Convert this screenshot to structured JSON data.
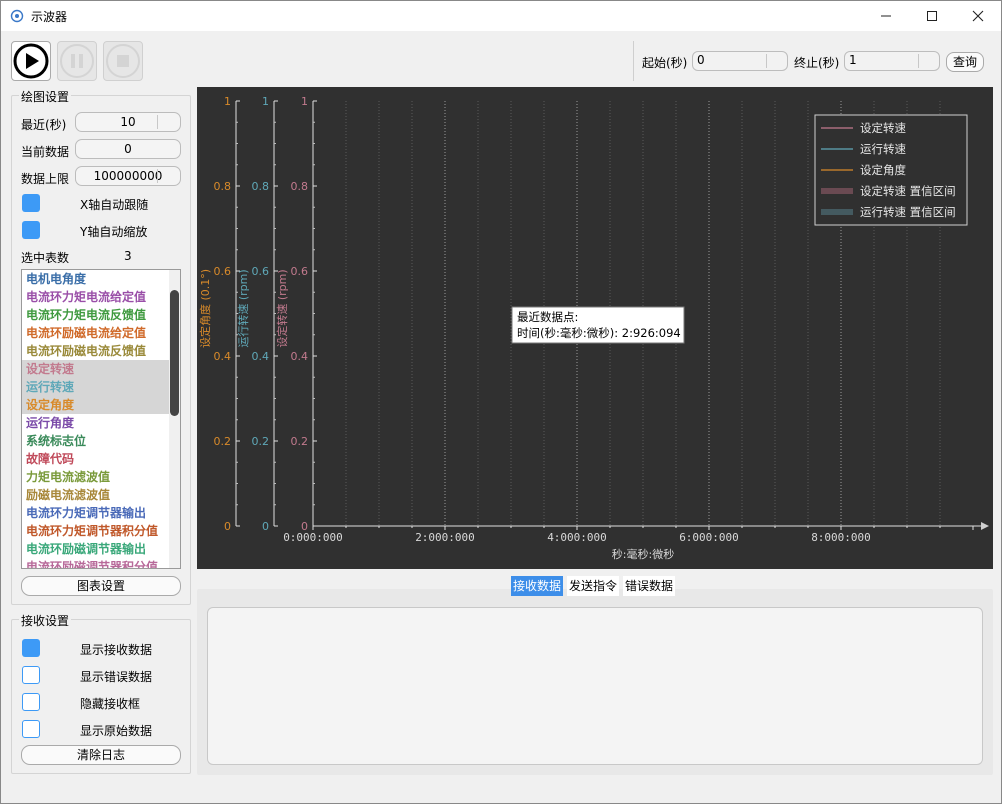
{
  "window": {
    "title": "示波器",
    "min_icon": "minimize-icon",
    "max_icon": "maximize-icon",
    "close_icon": "close-icon"
  },
  "toolbar": {
    "play_icon": "play-icon",
    "pause_icon": "pause-icon",
    "stop_icon": "stop-icon"
  },
  "query": {
    "start_label": "起始(秒)",
    "start_value": "0",
    "end_label": "终止(秒)",
    "end_value": "1",
    "button": "查询"
  },
  "plot_settings": {
    "title": "绘图设置",
    "recent_label": "最近(秒)",
    "recent_value": "10",
    "current_label": "当前数据",
    "current_value": "0",
    "limit_label": "数据上限",
    "limit_value": "100000000",
    "x_follow": "X轴自动跟随",
    "y_scale": "Y轴自动缩放",
    "selected_label": "选中表数",
    "selected_value": "3",
    "chart_settings_button": "图表设置",
    "items": [
      {
        "label": "电机电角度",
        "color": "#3a6ea8",
        "selected": false
      },
      {
        "label": "电流环力矩电流给定值",
        "color": "#9a4fa8",
        "selected": false
      },
      {
        "label": "电流环力矩电流反馈值",
        "color": "#3f9a3f",
        "selected": false
      },
      {
        "label": "电流环励磁电流给定值",
        "color": "#d06a2a",
        "selected": false
      },
      {
        "label": "电流环励磁电流反馈值",
        "color": "#9a8a3a",
        "selected": false
      },
      {
        "label": "设定转速",
        "color": "#c27a8e",
        "selected": true
      },
      {
        "label": "运行转速",
        "color": "#5fa8b8",
        "selected": true
      },
      {
        "label": "设定角度",
        "color": "#d88a2a",
        "selected": true
      },
      {
        "label": "运行角度",
        "color": "#7a4aa8",
        "selected": false
      },
      {
        "label": "系统标志位",
        "color": "#3a8a5a",
        "selected": false
      },
      {
        "label": "故障代码",
        "color": "#c04a5a",
        "selected": false
      },
      {
        "label": "力矩电流滤波值",
        "color": "#7a9a3a",
        "selected": false
      },
      {
        "label": "励磁电流滤波值",
        "color": "#a8883a",
        "selected": false
      },
      {
        "label": "电流环力矩调节器输出",
        "color": "#4a6ab8",
        "selected": false
      },
      {
        "label": "电流环力矩调节器积分值",
        "color": "#c0582a",
        "selected": false
      },
      {
        "label": "电流环励磁调节器输出",
        "color": "#3aa87a",
        "selected": false
      },
      {
        "label": "电流环励磁调节器积分值",
        "color": "#b86a9a",
        "selected": false
      }
    ]
  },
  "receive_settings": {
    "title": "接收设置",
    "options": [
      {
        "label": "显示接收数据",
        "checked": true
      },
      {
        "label": "显示错误数据",
        "checked": false
      },
      {
        "label": "隐藏接收框",
        "checked": false
      },
      {
        "label": "显示原始数据",
        "checked": false
      }
    ],
    "clear_button": "清除日志"
  },
  "tabs": [
    {
      "label": "接收数据",
      "active": true
    },
    {
      "label": "发送指令",
      "active": false
    },
    {
      "label": "错误数据",
      "active": false
    }
  ],
  "chart_data": {
    "type": "line",
    "x_ticks": [
      "0:000:000",
      "2:000:000",
      "4:000:000",
      "6:000:000",
      "8:000:000"
    ],
    "xlabel": "秒:毫秒:微秒",
    "y_axes": [
      {
        "label": "设定角度 (0.1°)",
        "color": "#d88a2a",
        "ticks": [
          "0",
          "0.2",
          "0.4",
          "0.6",
          "0.8",
          "1"
        ]
      },
      {
        "label": "运行转速 (rpm)",
        "color": "#5fa8b8",
        "ticks": [
          "0",
          "0.2",
          "0.4",
          "0.6",
          "0.8",
          "1"
        ]
      },
      {
        "label": "设定转速 (rpm)",
        "color": "#c27a8e",
        "ticks": [
          "0",
          "0.2",
          "0.4",
          "0.6",
          "0.8",
          "1"
        ]
      }
    ],
    "ylim": [
      0,
      1
    ],
    "series": [
      {
        "name": "设定转速",
        "color": "#c27a8e",
        "values": []
      },
      {
        "name": "运行转速",
        "color": "#5fa8b8",
        "values": []
      },
      {
        "name": "设定角度",
        "color": "#d88a2a",
        "values": []
      }
    ],
    "legend": [
      {
        "label": "设定转速",
        "kind": "line",
        "color": "#c27a8e"
      },
      {
        "label": "运行转速",
        "kind": "line",
        "color": "#5fa8b8"
      },
      {
        "label": "设定角度",
        "kind": "line",
        "color": "#d88a2a"
      },
      {
        "label": "设定转速 置信区间",
        "kind": "band",
        "color": "#6a4a52"
      },
      {
        "label": "运行转速 置信区间",
        "kind": "band",
        "color": "#445a60"
      }
    ],
    "legend_position": "top-right",
    "tooltip": {
      "line1": "最近数据点:",
      "line2": "时间(秒:毫秒:微秒): 2:926:094"
    },
    "grid": true
  }
}
